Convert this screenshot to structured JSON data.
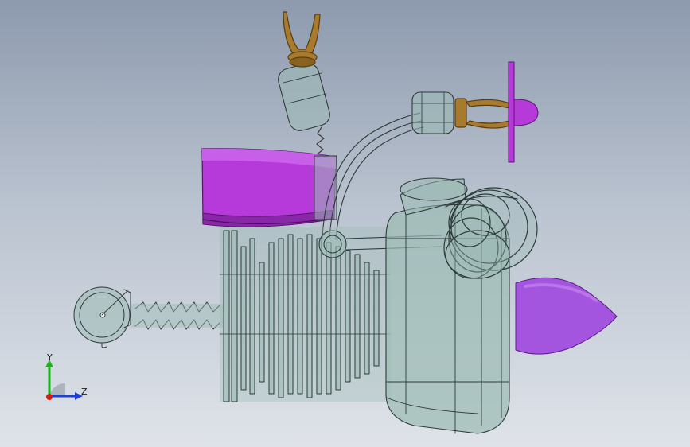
{
  "viewport": {
    "background_top": "#8d9aae",
    "background_bottom": "#dfe3e9"
  },
  "colors": {
    "transparent_part_fill": "#9bbab4",
    "wire_edge": "#2c3b38",
    "magenta_part": "#b63ad9",
    "magenta_dark": "#7a1f9a",
    "violet_nose": "#a455e0",
    "bronze_clip": "#a77a2e",
    "axis_y": "#19b219",
    "axis_z": "#1f3fd9",
    "axis_x": "#d21a1a"
  },
  "triad": {
    "y_label": "Y",
    "z_label": "Z"
  },
  "icons": {
    "triad": "coordinate-triad-icon"
  }
}
